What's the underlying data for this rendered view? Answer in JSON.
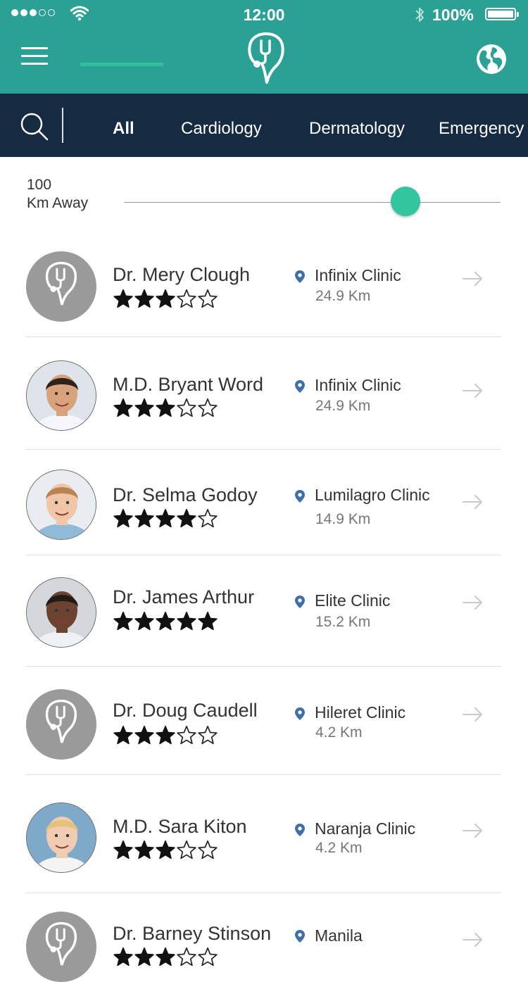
{
  "status_bar": {
    "time": "12:00",
    "battery": "100%",
    "signal_bars_filled": 3,
    "signal_bars_total": 5
  },
  "header": {
    "menu_icon": "hamburger-menu-icon",
    "logo_icon": "stethoscope-logo-icon",
    "globe_icon": "globe-icon"
  },
  "colors": {
    "header": "#2aa194",
    "nav": "#162a41",
    "accent": "#33c59e",
    "pin": "#3f6fa8"
  },
  "categories": {
    "search_icon": "search-icon",
    "tabs": [
      {
        "label": "All",
        "active": true
      },
      {
        "label": "Cardiology",
        "active": false
      },
      {
        "label": "Dermatology",
        "active": false
      },
      {
        "label": "Emergency",
        "active": false
      }
    ]
  },
  "distance_filter": {
    "value": "100",
    "unit_label": "Km Away",
    "slider_fraction": 0.75
  },
  "doctors": [
    {
      "name": "Dr. Mery Clough",
      "rating": 3,
      "clinic": "Infinix Clinic",
      "distance": "24.9 Km",
      "avatar": "generic"
    },
    {
      "name": "M.D. Bryant Word",
      "rating": 3,
      "clinic": "Infinix Clinic",
      "distance": "24.9 Km",
      "avatar": "photo"
    },
    {
      "name": "Dr. Selma Godoy",
      "rating": 4,
      "clinic": "Lumilagro Clinic",
      "distance": "14.9 Km",
      "avatar": "photo"
    },
    {
      "name": "Dr. James Arthur",
      "rating": 5,
      "clinic": "Elite Clinic",
      "distance": "15.2 Km",
      "avatar": "photo"
    },
    {
      "name": "Dr. Doug Caudell",
      "rating": 3,
      "clinic": "Hileret Clinic",
      "distance": "4.2 Km",
      "avatar": "generic"
    },
    {
      "name": "M.D. Sara Kiton",
      "rating": 3,
      "clinic": "Naranja Clinic",
      "distance": "4.2 Km",
      "avatar": "photo"
    },
    {
      "name": "Dr. Barney Stinson",
      "rating": 3,
      "clinic": "Manila",
      "distance": "",
      "avatar": "generic"
    }
  ]
}
